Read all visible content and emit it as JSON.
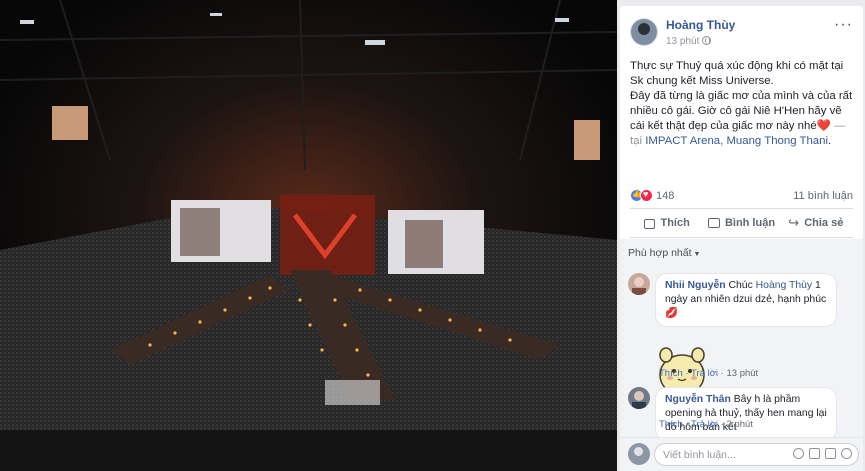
{
  "post": {
    "author": "Hoàng Thùy",
    "time": "13 phút",
    "text_line1": "Thực sự Thuỷ quá xúc động khi có mặt tại Sk chung kết Miss Universe.",
    "text_line2a": "Đây đã từng là giấc mơ của mình và của rất nhiều cô gái. Giờ cô gái Niê H'Hen hãy vẽ cái kết thật đẹp của giấc mơ này nhé",
    "heart": "❤️",
    "at_prefix": " — tại ",
    "location": "IMPACT Arena, Muang Thong Thani",
    "period": ".",
    "more": "···"
  },
  "stats": {
    "reactions": "148",
    "comments": "11 bình luận"
  },
  "actions": {
    "like": "Thích",
    "comment": "Bình luận",
    "share": "Chia sẻ"
  },
  "filter": {
    "label": "Phù hợp nhất"
  },
  "comments": [
    {
      "name": "Nhii Nguyễn",
      "text_before": " Chúc ",
      "mention": "Hoàng Thùy",
      "text_after": " 1 ngày an nhiên dzui dzẻ, hạnh phúc 💋",
      "like": "Thích",
      "reply": "Trả lời",
      "time": "13 phút"
    },
    {
      "name": "Nguyễn Thân",
      "text": " Bây h là phầm opening hả thuỷ, thấy hen mang lại đồ hôm bán kết",
      "like": "Thích",
      "reply": "Trả lời",
      "time": "2 phút"
    }
  ],
  "composer": {
    "placeholder": "Viết bình luận..."
  },
  "colors": {
    "link": "#365899",
    "panel_bg": "#ffffff",
    "comments_bg": "#f2f3f5",
    "photo_bg": "#000000"
  }
}
